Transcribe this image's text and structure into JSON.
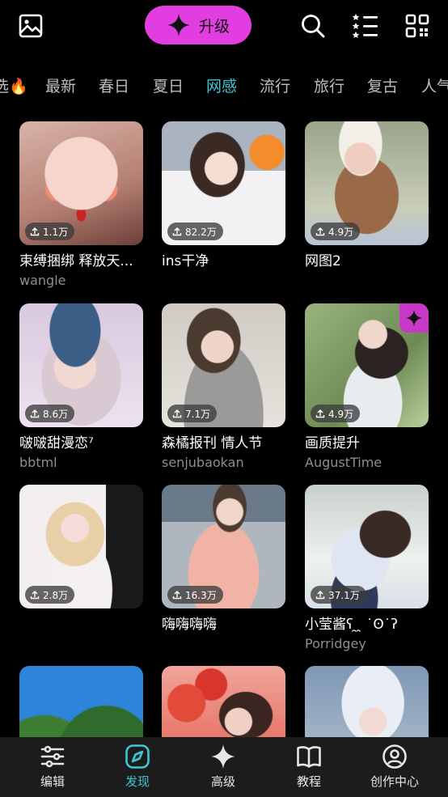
{
  "header": {
    "upgrade_label": "升级",
    "left_icon": "gallery-icon",
    "right_icons": [
      "search-icon",
      "star-list-icon",
      "qr-code-icon"
    ],
    "accent_color": "#e23de0"
  },
  "tabs": [
    {
      "label": "选🔥"
    },
    {
      "label": "最新"
    },
    {
      "label": "春日"
    },
    {
      "label": "夏日"
    },
    {
      "label": "网感",
      "active": true
    },
    {
      "label": "流行"
    },
    {
      "label": "旅行"
    },
    {
      "label": "复古"
    },
    {
      "label": "人气"
    }
  ],
  "active_tab_color": "#3ec7d3",
  "cards": [
    {
      "count": "1.1万",
      "title": "束缚捆绑 释放天...",
      "author": "wangle"
    },
    {
      "count": "82.2万",
      "title": "ins干净",
      "author": ""
    },
    {
      "count": "4.9万",
      "title": "网图2",
      "author": ""
    },
    {
      "count": "8.6万",
      "title": "啵啵甜漫恋⁷",
      "author": "bbtml"
    },
    {
      "count": "7.1万",
      "title": "森橘报刊 情人节",
      "author": "senjubaokan"
    },
    {
      "count": "4.9万",
      "title": "画质提升",
      "author": "AugustTime",
      "pro": true
    },
    {
      "count": "2.8万",
      "title": "",
      "author": ""
    },
    {
      "count": "16.3万",
      "title": "嗨嗨嗨嗨",
      "author": ""
    },
    {
      "count": "37.1万",
      "title": "小莹酱ʕ ̯ ̯ ˙ʘ˙ʔ",
      "author": "Porridgey"
    }
  ],
  "bottom_nav": [
    {
      "label": "编辑",
      "icon": "sliders-icon"
    },
    {
      "label": "发现",
      "icon": "compass-icon",
      "active": true
    },
    {
      "label": "高级",
      "icon": "sparkle-icon"
    },
    {
      "label": "教程",
      "icon": "book-icon"
    },
    {
      "label": "创作中心",
      "icon": "user-circle-icon"
    }
  ]
}
